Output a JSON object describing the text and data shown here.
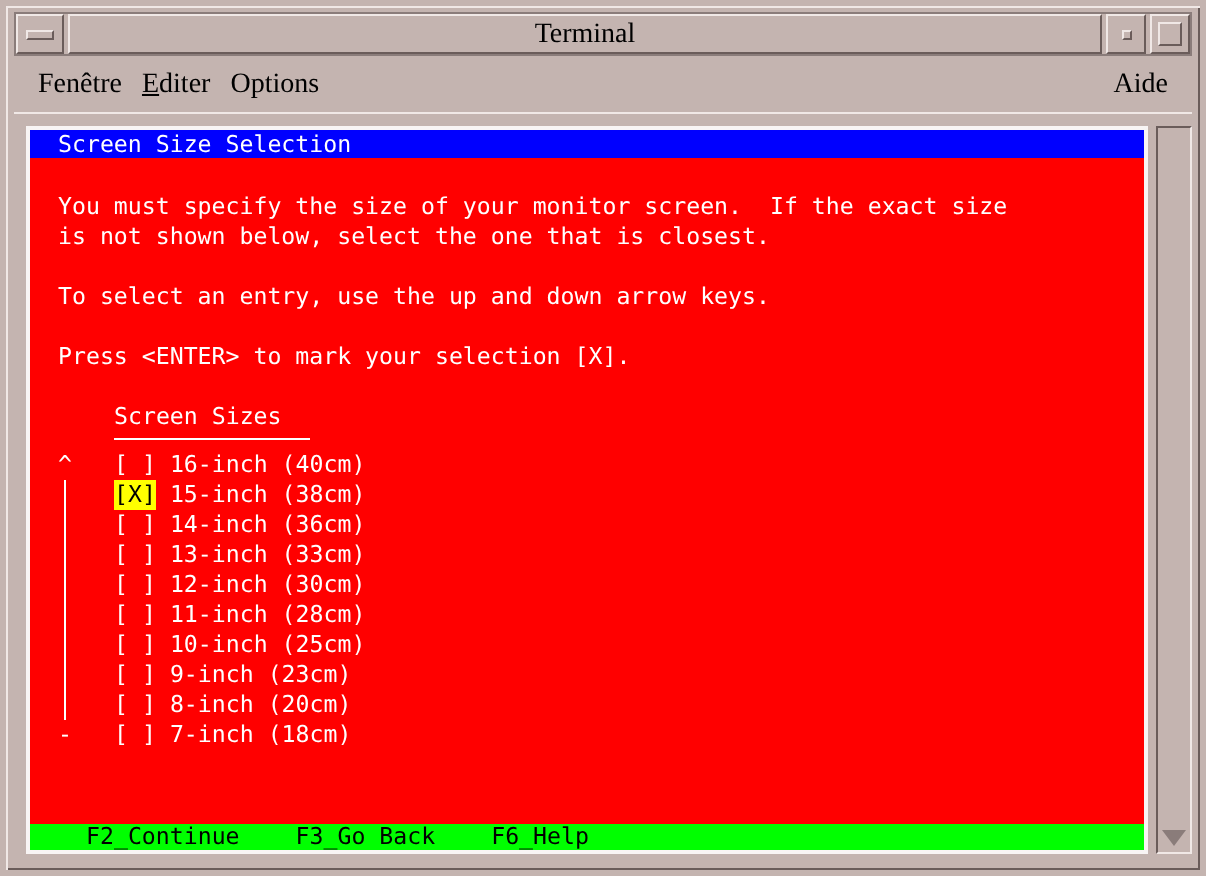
{
  "window": {
    "title": "Terminal"
  },
  "menu": [
    {
      "kind": "plain",
      "label": "Fenêtre"
    },
    {
      "kind": "mnemonic",
      "underlined": "E",
      "rest": "diter"
    },
    {
      "kind": "plain",
      "label": "Options"
    }
  ],
  "help_menu": {
    "label": "Aide"
  },
  "dialog": {
    "title": "Screen Size Selection",
    "paragraphs": [
      [
        "You must specify the size of your monitor screen.  If the exact size",
        "is not shown below, select the one that is closest."
      ],
      [
        "To select an entry, use the up and down arrow keys."
      ],
      [
        "Press <ENTER> to mark your selection [X]."
      ]
    ],
    "list_heading": "Screen Sizes",
    "scroll_indicator": {
      "top": "^",
      "bottom": "-"
    },
    "items": [
      {
        "box": "[ ]",
        "label": "16-inch (40cm)",
        "checked": false
      },
      {
        "box": "[X]",
        "label": "15-inch (38cm)",
        "checked": true
      },
      {
        "box": "[ ]",
        "label": "14-inch (36cm)",
        "checked": false
      },
      {
        "box": "[ ]",
        "label": "13-inch (33cm)",
        "checked": false
      },
      {
        "box": "[ ]",
        "label": "12-inch (30cm)",
        "checked": false
      },
      {
        "box": "[ ]",
        "label": "11-inch (28cm)",
        "checked": false
      },
      {
        "box": "[ ]",
        "label": "10-inch (25cm)",
        "checked": false
      },
      {
        "box": "[ ]",
        "label": "9-inch (23cm)",
        "checked": false
      },
      {
        "box": "[ ]",
        "label": "8-inch (20cm)",
        "checked": false
      },
      {
        "box": "[ ]",
        "label": "7-inch (18cm)",
        "checked": false
      }
    ]
  },
  "function_keys": [
    "F2_Continue",
    "F3_Go Back",
    "F6_Help"
  ]
}
